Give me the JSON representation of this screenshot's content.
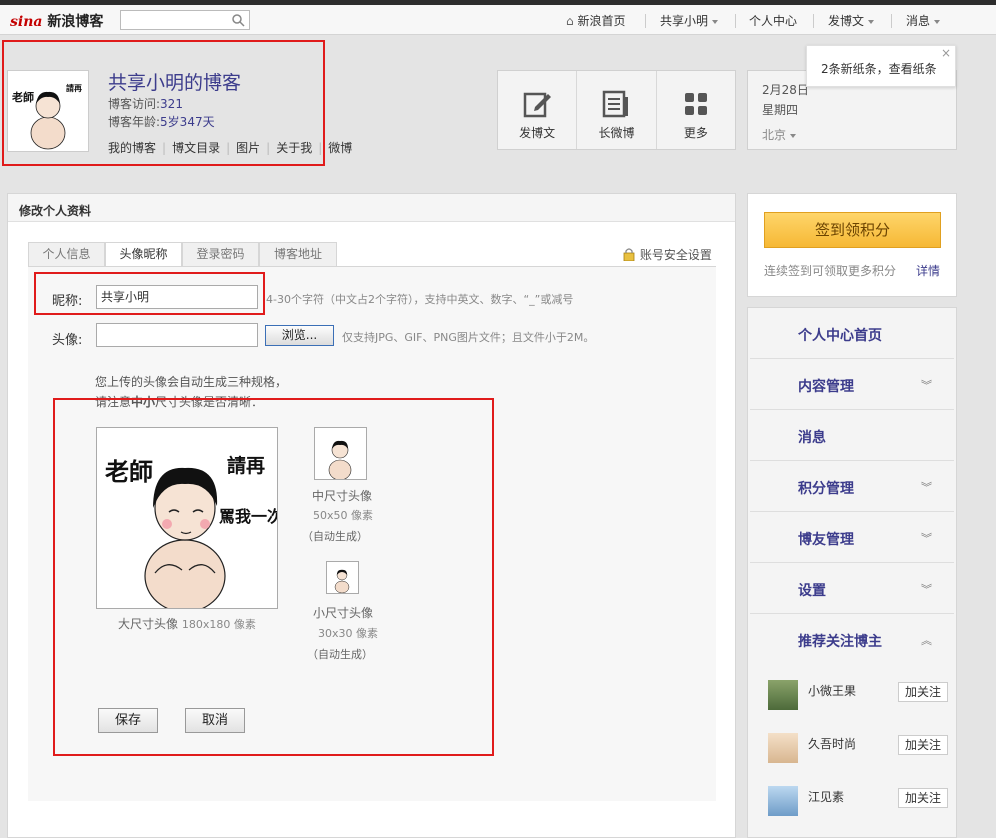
{
  "topbar": {
    "logo_brand": "sina",
    "logo_text": "新浪博客",
    "search_placeholder": "",
    "links": [
      "新浪首页",
      "共享小明",
      "个人中心",
      "发博文",
      "消息"
    ]
  },
  "notice": {
    "text": "2条新纸条，查看纸条",
    "close": "×"
  },
  "blog": {
    "title": "共享小明的博客",
    "visits_label": "博客访问:",
    "visits": "321",
    "age_label": "博客年龄:",
    "age": "5岁347天",
    "menu": [
      "我的博客",
      "博文目录",
      "图片",
      "关于我",
      "微博"
    ]
  },
  "tools": [
    {
      "label": "发博文",
      "icon": "edit-icon"
    },
    {
      "label": "长微博",
      "icon": "document-icon"
    },
    {
      "label": "更多",
      "icon": "grid-icon"
    }
  ],
  "datebox": {
    "date": "2月28日",
    "weekday": "星期四",
    "city": "北京"
  },
  "panel": {
    "title": "修改个人资料",
    "tabs": [
      "个人信息",
      "头像昵称",
      "登录密码",
      "博客地址"
    ],
    "active_tab": 1,
    "security_link": "账号安全设置"
  },
  "form": {
    "nick_label": "昵称:",
    "nick_value": "共享小明",
    "nick_hint": "4-30个字符（中文占2个字符），支持中英文、数字、“_”或减号",
    "avatar_label": "头像:",
    "browse_label": "浏览...",
    "avatar_hint": "仅支持JPG、GIF、PNG图片文件；且文件小于2M。",
    "note_line1": "您上传的头像会自动生成三种规格，",
    "note_line2_a": "请注意",
    "note_line2_b": "中小",
    "note_line2_c": "尺寸头像是否清晰：",
    "large_caption": "大尺寸头像",
    "large_size": "180x180 像素",
    "mid_caption": "中尺寸头像",
    "mid_size": "50x50 像素",
    "mid_auto": "（自动生成）",
    "small_caption": "小尺寸头像",
    "small_size": "30x30 像素",
    "small_auto": "（自动生成）",
    "save": "保存",
    "cancel": "取消"
  },
  "avatar_text": {
    "big1": "老師",
    "big2": "請再",
    "big3": "罵我一次"
  },
  "sidebar": {
    "sign_button": "签到领积分",
    "sign_tip": "连续签到可领取更多积分",
    "sign_more": "详情",
    "menu": [
      {
        "label": "个人中心首页",
        "arrow": ""
      },
      {
        "label": "内容管理",
        "arrow": "v"
      },
      {
        "label": "消息",
        "arrow": ""
      },
      {
        "label": "积分管理",
        "arrow": "v"
      },
      {
        "label": "博友管理",
        "arrow": "v"
      },
      {
        "label": "设置",
        "arrow": "v"
      },
      {
        "label": "推荐关注博主",
        "arrow": "^"
      }
    ],
    "friends": [
      {
        "name": "小微王果",
        "follow": "加关注"
      },
      {
        "name": "久吾时尚",
        "follow": "加关注"
      },
      {
        "name": "江见素",
        "follow": "加关注"
      }
    ]
  },
  "colors": {
    "accent": "#3c3c8c",
    "highlight_box": "#e01b1b",
    "sign": "#f6b835"
  }
}
